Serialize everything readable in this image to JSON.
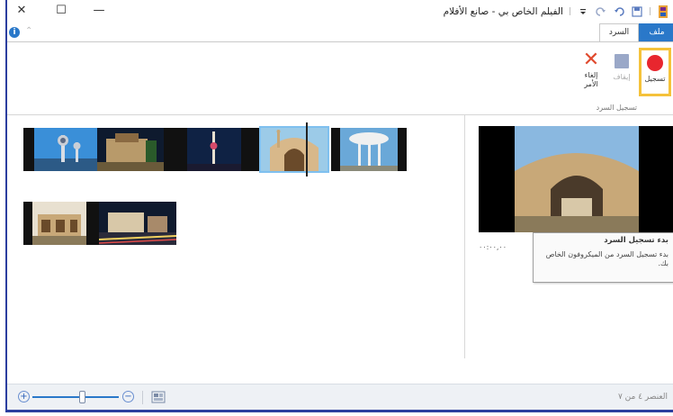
{
  "window": {
    "title": "الفيلم الخاص بي - صانع الأفلام",
    "title_separator": "|",
    "controls": {
      "close": "✕",
      "maximize": "☐",
      "minimize": "—"
    }
  },
  "tabs": [
    {
      "label": "ملف",
      "active": false,
      "color": "#2a78c9"
    },
    {
      "label": "السرد",
      "active": true
    }
  ],
  "ribbon": {
    "buttons": [
      {
        "label": "تسجيل",
        "icon": "record-dot-icon",
        "highlighted": true,
        "color": "#e8262e"
      },
      {
        "label": "إيقاف",
        "icon": "stop-square-icon",
        "enabled": false
      },
      {
        "label_line1": "إلغاء",
        "label_line2": "الأمر",
        "icon": "cancel-x-icon",
        "color": "#e04a2e"
      }
    ],
    "group_label": "تسجيل السرد"
  },
  "tooltip": {
    "title": "بدء تسجيل السرد",
    "body": "بدء تسجيل السرد من الميكروفون الخاص بك."
  },
  "preview": {
    "time": "٠٠:٠٠,٠٠"
  },
  "status": {
    "text": "العنصر ٤ من ٧"
  },
  "colors": {
    "accent": "#2a78c9",
    "highlight": "#f5c23a",
    "frame": "#2b3e9f"
  }
}
